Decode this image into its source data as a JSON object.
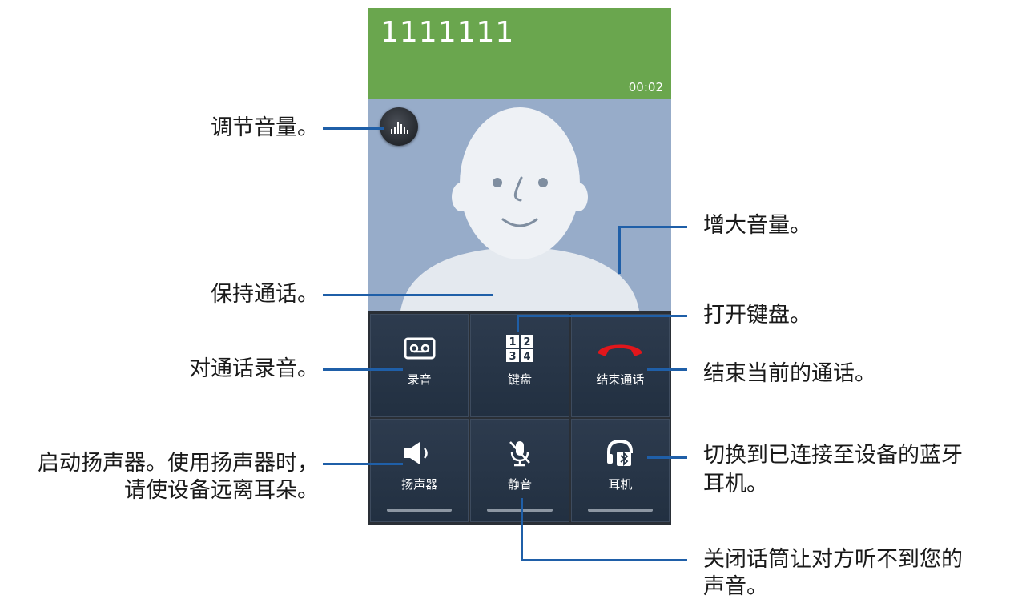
{
  "screen": {
    "caller_number": "1111111",
    "call_timer": "00:02",
    "hold_label": "保持",
    "buttons": [
      {
        "label": "录音",
        "icon": "cassette-record-icon"
      },
      {
        "label": "键盘",
        "icon": "keypad-icon"
      },
      {
        "label": "结束通话",
        "icon": "end-call-icon"
      },
      {
        "label": "扬声器",
        "icon": "speaker-icon"
      },
      {
        "label": "静音",
        "icon": "mic-mute-icon"
      },
      {
        "label": "耳机",
        "icon": "bluetooth-headset-icon"
      }
    ],
    "colors": {
      "header": "#6aa64e",
      "photo_bg": "#97acc9",
      "end_call": "#e1161b",
      "grid_bg": "#223041"
    }
  },
  "annotations": {
    "volume": "调节音量。",
    "boost": "增大音量。",
    "hold": "保持通话。",
    "keypad": "打开键盘。",
    "record": "对通话录音。",
    "end": "结束当前的通话。",
    "speaker_line1": "启动扬声器。使用扬声器时，",
    "speaker_line2": "请使设备远离耳朵。",
    "bluetooth_line1": "切换到已连接至设备的蓝牙",
    "bluetooth_line2": "耳机。",
    "mute_line1": "关闭话筒让对方听不到您的",
    "mute_line2": "声音。"
  }
}
